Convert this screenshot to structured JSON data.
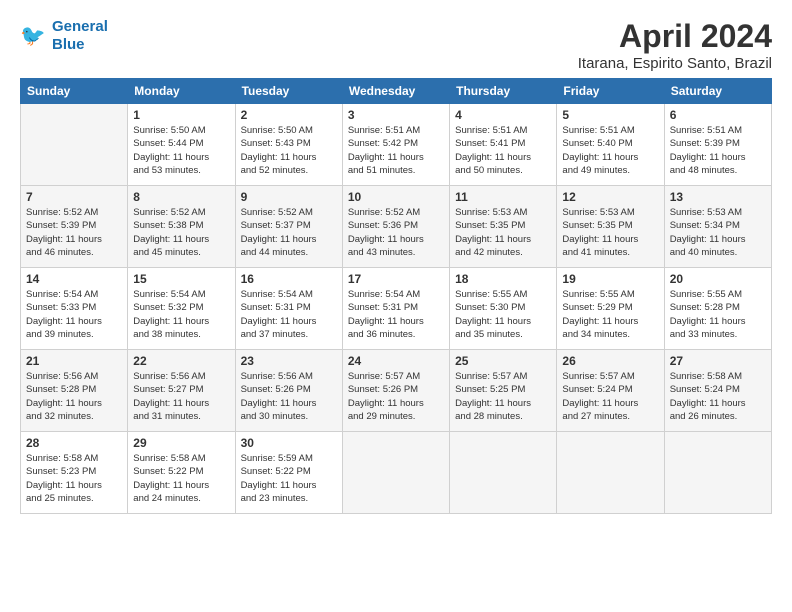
{
  "header": {
    "logo_line1": "General",
    "logo_line2": "Blue",
    "title": "April 2024",
    "subtitle": "Itarana, Espirito Santo, Brazil"
  },
  "days_of_week": [
    "Sunday",
    "Monday",
    "Tuesday",
    "Wednesday",
    "Thursday",
    "Friday",
    "Saturday"
  ],
  "weeks": [
    [
      {
        "day": "",
        "info": ""
      },
      {
        "day": "1",
        "info": "Sunrise: 5:50 AM\nSunset: 5:44 PM\nDaylight: 11 hours\nand 53 minutes."
      },
      {
        "day": "2",
        "info": "Sunrise: 5:50 AM\nSunset: 5:43 PM\nDaylight: 11 hours\nand 52 minutes."
      },
      {
        "day": "3",
        "info": "Sunrise: 5:51 AM\nSunset: 5:42 PM\nDaylight: 11 hours\nand 51 minutes."
      },
      {
        "day": "4",
        "info": "Sunrise: 5:51 AM\nSunset: 5:41 PM\nDaylight: 11 hours\nand 50 minutes."
      },
      {
        "day": "5",
        "info": "Sunrise: 5:51 AM\nSunset: 5:40 PM\nDaylight: 11 hours\nand 49 minutes."
      },
      {
        "day": "6",
        "info": "Sunrise: 5:51 AM\nSunset: 5:39 PM\nDaylight: 11 hours\nand 48 minutes."
      }
    ],
    [
      {
        "day": "7",
        "info": "Sunrise: 5:52 AM\nSunset: 5:39 PM\nDaylight: 11 hours\nand 46 minutes."
      },
      {
        "day": "8",
        "info": "Sunrise: 5:52 AM\nSunset: 5:38 PM\nDaylight: 11 hours\nand 45 minutes."
      },
      {
        "day": "9",
        "info": "Sunrise: 5:52 AM\nSunset: 5:37 PM\nDaylight: 11 hours\nand 44 minutes."
      },
      {
        "day": "10",
        "info": "Sunrise: 5:52 AM\nSunset: 5:36 PM\nDaylight: 11 hours\nand 43 minutes."
      },
      {
        "day": "11",
        "info": "Sunrise: 5:53 AM\nSunset: 5:35 PM\nDaylight: 11 hours\nand 42 minutes."
      },
      {
        "day": "12",
        "info": "Sunrise: 5:53 AM\nSunset: 5:35 PM\nDaylight: 11 hours\nand 41 minutes."
      },
      {
        "day": "13",
        "info": "Sunrise: 5:53 AM\nSunset: 5:34 PM\nDaylight: 11 hours\nand 40 minutes."
      }
    ],
    [
      {
        "day": "14",
        "info": "Sunrise: 5:54 AM\nSunset: 5:33 PM\nDaylight: 11 hours\nand 39 minutes."
      },
      {
        "day": "15",
        "info": "Sunrise: 5:54 AM\nSunset: 5:32 PM\nDaylight: 11 hours\nand 38 minutes."
      },
      {
        "day": "16",
        "info": "Sunrise: 5:54 AM\nSunset: 5:31 PM\nDaylight: 11 hours\nand 37 minutes."
      },
      {
        "day": "17",
        "info": "Sunrise: 5:54 AM\nSunset: 5:31 PM\nDaylight: 11 hours\nand 36 minutes."
      },
      {
        "day": "18",
        "info": "Sunrise: 5:55 AM\nSunset: 5:30 PM\nDaylight: 11 hours\nand 35 minutes."
      },
      {
        "day": "19",
        "info": "Sunrise: 5:55 AM\nSunset: 5:29 PM\nDaylight: 11 hours\nand 34 minutes."
      },
      {
        "day": "20",
        "info": "Sunrise: 5:55 AM\nSunset: 5:28 PM\nDaylight: 11 hours\nand 33 minutes."
      }
    ],
    [
      {
        "day": "21",
        "info": "Sunrise: 5:56 AM\nSunset: 5:28 PM\nDaylight: 11 hours\nand 32 minutes."
      },
      {
        "day": "22",
        "info": "Sunrise: 5:56 AM\nSunset: 5:27 PM\nDaylight: 11 hours\nand 31 minutes."
      },
      {
        "day": "23",
        "info": "Sunrise: 5:56 AM\nSunset: 5:26 PM\nDaylight: 11 hours\nand 30 minutes."
      },
      {
        "day": "24",
        "info": "Sunrise: 5:57 AM\nSunset: 5:26 PM\nDaylight: 11 hours\nand 29 minutes."
      },
      {
        "day": "25",
        "info": "Sunrise: 5:57 AM\nSunset: 5:25 PM\nDaylight: 11 hours\nand 28 minutes."
      },
      {
        "day": "26",
        "info": "Sunrise: 5:57 AM\nSunset: 5:24 PM\nDaylight: 11 hours\nand 27 minutes."
      },
      {
        "day": "27",
        "info": "Sunrise: 5:58 AM\nSunset: 5:24 PM\nDaylight: 11 hours\nand 26 minutes."
      }
    ],
    [
      {
        "day": "28",
        "info": "Sunrise: 5:58 AM\nSunset: 5:23 PM\nDaylight: 11 hours\nand 25 minutes."
      },
      {
        "day": "29",
        "info": "Sunrise: 5:58 AM\nSunset: 5:22 PM\nDaylight: 11 hours\nand 24 minutes."
      },
      {
        "day": "30",
        "info": "Sunrise: 5:59 AM\nSunset: 5:22 PM\nDaylight: 11 hours\nand 23 minutes."
      },
      {
        "day": "",
        "info": ""
      },
      {
        "day": "",
        "info": ""
      },
      {
        "day": "",
        "info": ""
      },
      {
        "day": "",
        "info": ""
      }
    ]
  ]
}
